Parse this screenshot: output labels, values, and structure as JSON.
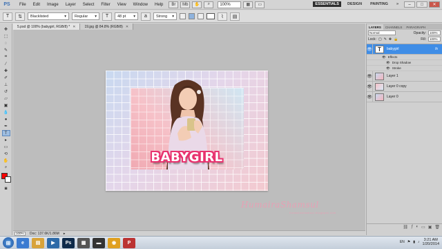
{
  "menubar": {
    "logo": "PS",
    "items": [
      "File",
      "Edit",
      "Image",
      "Layer",
      "Select",
      "Filter",
      "View",
      "Window",
      "Help"
    ],
    "zoom": "100%",
    "workspaces": [
      "ESSENTIALS",
      "DESIGN",
      "PAINTING"
    ],
    "more": "»"
  },
  "options": {
    "tool_icon": "T",
    "font_family": "Blacklisted",
    "font_style": "Regular",
    "font_size": "48 pt",
    "antialias_prefix": "a",
    "antialias": "Strong"
  },
  "tabs": [
    {
      "label": "5.psd @ 100% (babygirl, RGB/8) *"
    },
    {
      "label": "19.jpg @ 84.8% (RGB/8)"
    }
  ],
  "canvas": {
    "text": "BABYGIRL",
    "watermark": "HumairaShamsul",
    "watermark_sub": "humairashamsul.blogspot.com"
  },
  "status": {
    "zoom": "100%",
    "doc": "Doc: 137.6K/1.86M"
  },
  "panel": {
    "tabs": [
      "LAYERS",
      "CHANNELS",
      "PARAGRAPH"
    ],
    "blend_mode": "Normal",
    "opacity_label": "Opacity:",
    "opacity": "100%",
    "lock_label": "Lock:",
    "fill_label": "Fill:",
    "fill": "100%",
    "layers": [
      {
        "name": "babygirl",
        "thumb": "T",
        "fx": "fx",
        "selected": true
      },
      {
        "name": "Layer 1"
      },
      {
        "name": "Layer 0 copy"
      },
      {
        "name": "Layer 0"
      }
    ],
    "effects_label": "Effects",
    "effects": [
      "Drop Shadow",
      "Stroke"
    ]
  },
  "taskbar": {
    "lang": "EN",
    "time": "3:21 AM",
    "date": "1/20/2014"
  },
  "colors": {
    "foreground": "#ff0000",
    "background": "#ffffff",
    "text_stroke": "#e8336f",
    "selected_layer": "#3f8de6"
  }
}
